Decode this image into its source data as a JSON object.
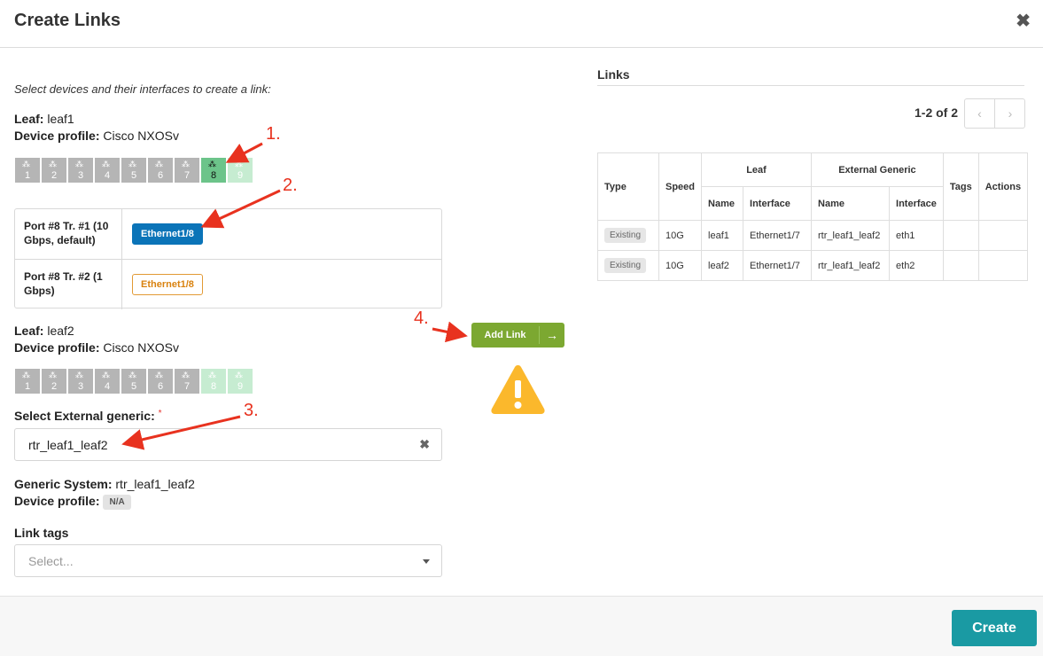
{
  "dialog": {
    "title": "Create Links"
  },
  "instructions": "Select devices and their interfaces to create a link:",
  "leaf1": {
    "label": "Leaf:",
    "name": "leaf1",
    "profile_label": "Device profile:",
    "profile": "Cisco NXOSv",
    "ports": [
      "1",
      "2",
      "3",
      "4",
      "5",
      "6",
      "7",
      "8",
      "9"
    ]
  },
  "transforms": [
    {
      "label": "Port #8 Tr. #1 (10 Gbps, default)",
      "interface": "Ethernet1/8",
      "state": "selected"
    },
    {
      "label": "Port #8 Tr. #2 (1 Gbps)",
      "interface": "Ethernet1/8",
      "state": "available"
    }
  ],
  "leaf2": {
    "label": "Leaf:",
    "name": "leaf2",
    "profile_label": "Device profile:",
    "profile": "Cisco NXOSv",
    "ports": [
      "1",
      "2",
      "3",
      "4",
      "5",
      "6",
      "7",
      "8",
      "9"
    ]
  },
  "external": {
    "label": "Select External generic:",
    "required_mark": "*",
    "value": "rtr_leaf1_leaf2"
  },
  "generic": {
    "label": "Generic System:",
    "name": "rtr_leaf1_leaf2",
    "profile_label": "Device profile:",
    "profile": "N/A"
  },
  "tags": {
    "label": "Link tags",
    "placeholder": "Select..."
  },
  "add_link": {
    "label": "Add Link",
    "arrow": "→"
  },
  "warning_icon": "warning-triangle-icon",
  "links": {
    "title": "Links",
    "pagination": "1-2 of 2",
    "headers": {
      "type": "Type",
      "speed": "Speed",
      "leaf": "Leaf",
      "external": "External Generic",
      "tags": "Tags",
      "actions": "Actions",
      "name": "Name",
      "interface": "Interface"
    },
    "rows": [
      {
        "type": "Existing",
        "speed": "10G",
        "leaf_name": "leaf1",
        "leaf_if": "Ethernet1/7",
        "ext_name": "rtr_leaf1_leaf2",
        "ext_if": "eth1"
      },
      {
        "type": "Existing",
        "speed": "10G",
        "leaf_name": "leaf2",
        "leaf_if": "Ethernet1/7",
        "ext_name": "rtr_leaf1_leaf2",
        "ext_if": "eth2"
      }
    ]
  },
  "annotations": [
    "1.",
    "2.",
    "3.",
    "4."
  ],
  "footer": {
    "create_label": "Create"
  },
  "colors": {
    "accent": "#1a9aa3",
    "add_link": "#7ca831",
    "interface_active": "#0b74b8",
    "annotation": "#e8321f",
    "warning": "#fbb82c"
  }
}
